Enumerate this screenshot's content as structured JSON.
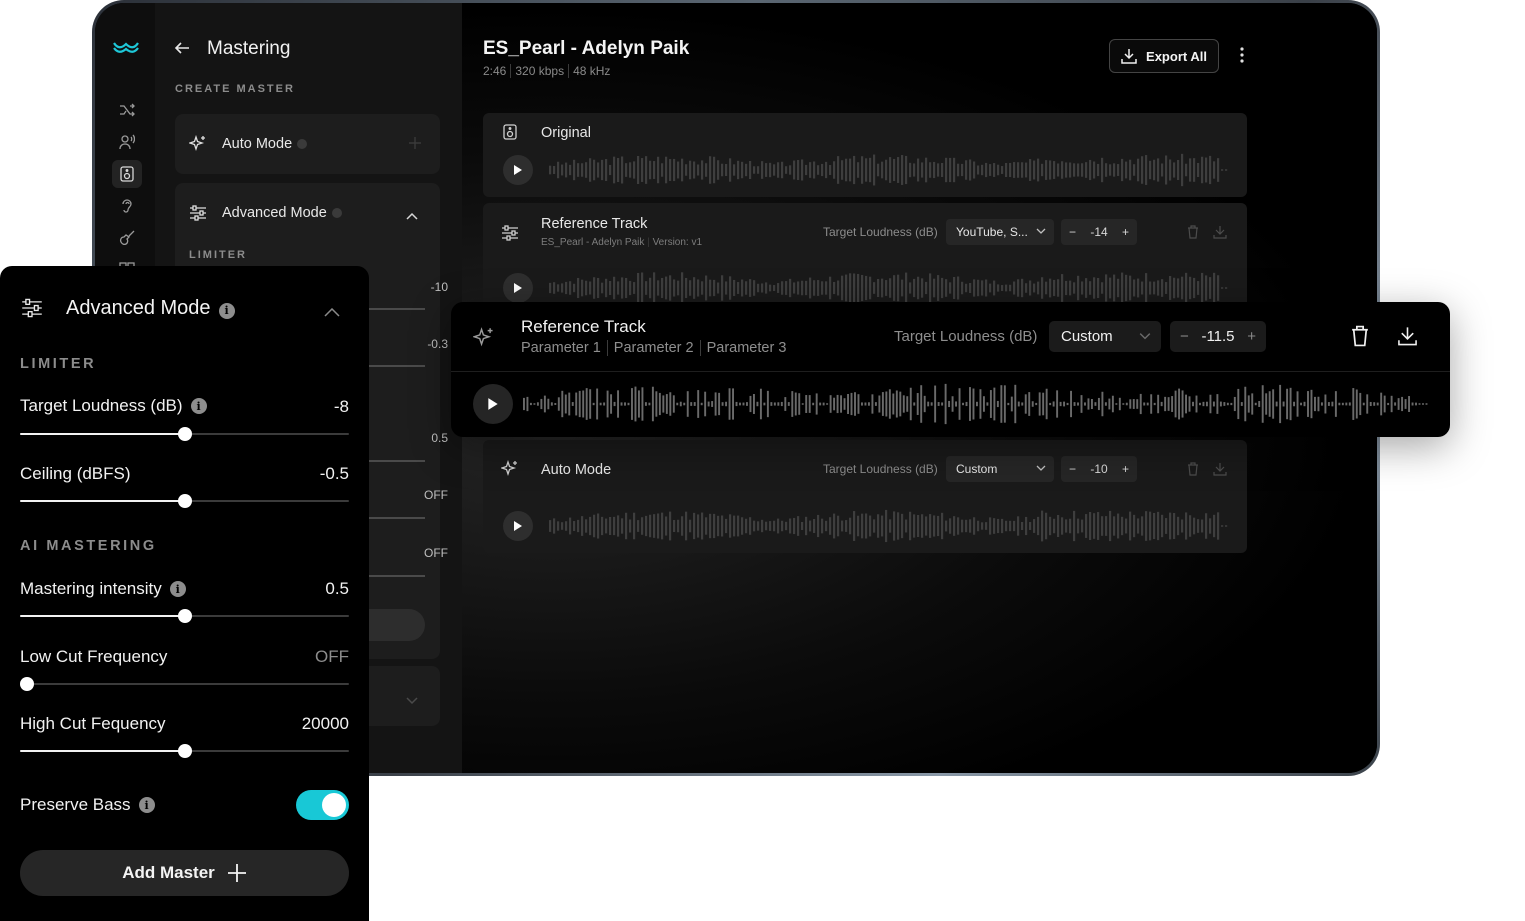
{
  "app": {
    "logo_icon": "wave-logo-icon",
    "accent_color": "#18c8d6"
  },
  "rail": {
    "icons": [
      "shuffle-icon",
      "voice-icon",
      "speaker-icon",
      "ear-icon",
      "guitar-icon",
      "grid-icon"
    ],
    "active_index": 2
  },
  "side": {
    "title": "Mastering",
    "create_caption": "CREATE MASTER",
    "auto_mode_label": "Auto Mode",
    "advanced_mode_label": "Advanced Mode",
    "limiter_caption": "LIMITER",
    "bg_values": [
      "-10",
      "-0.3",
      "0.5",
      "OFF",
      "OFF"
    ]
  },
  "main": {
    "track_title": "ES_Pearl - Adelyn Paik",
    "meta": [
      "2:46",
      "320 kbps",
      "48 kHz"
    ],
    "export_label": "Export All",
    "tracks": [
      {
        "name": "Original"
      },
      {
        "name": "Reference Track",
        "sub": [
          "ES_Pearl - Adelyn Paik",
          "Version: v1"
        ],
        "loudness_label": "Target Loudness (dB)",
        "preset": "YouTube, S...",
        "value": "-14"
      },
      {
        "name": "Auto Mode",
        "loudness_label": "Target Loudness (dB)",
        "preset": "Custom",
        "value": "-10"
      }
    ]
  },
  "floating_track": {
    "name": "Reference Track",
    "params": [
      "Parameter 1",
      "Parameter 2",
      "Parameter 3"
    ],
    "loudness_label": "Target Loudness (dB)",
    "preset": "Custom",
    "value": "-11.5"
  },
  "advanced": {
    "title": "Advanced Mode",
    "limiter_caption": "LIMITER",
    "ai_caption": "AI MASTERING",
    "rows": [
      {
        "label": "Target Loudness (dB)",
        "value": "-8",
        "info": true,
        "fraction": 0.5
      },
      {
        "label": "Ceiling (dBFS)",
        "value": "-0.5",
        "info": false,
        "fraction": 0.5
      },
      {
        "label": "Mastering intensity",
        "value": "0.5",
        "info": true,
        "fraction": 0.5
      },
      {
        "label": "Low Cut Frequency",
        "value": "OFF",
        "info": false,
        "fraction": 0.0
      },
      {
        "label": "High Cut Fequency",
        "value": "20000",
        "info": false,
        "fraction": 0.5
      }
    ],
    "preserve_bass_label": "Preserve Bass",
    "preserve_bass_on": true,
    "add_master_label": "Add Master"
  }
}
